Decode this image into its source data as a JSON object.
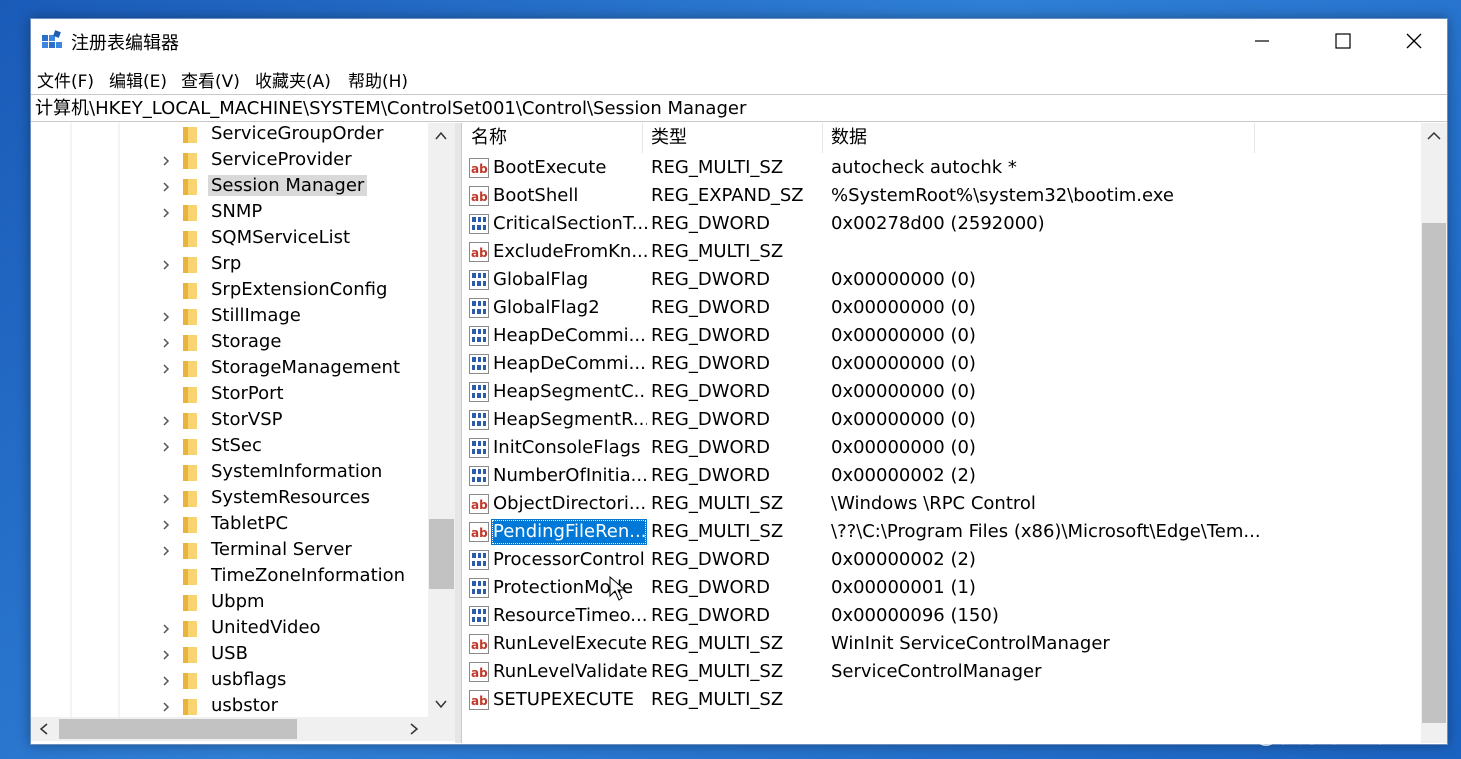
{
  "window": {
    "title": "注册表编辑器"
  },
  "menu": [
    "文件(F)",
    "编辑(E)",
    "查看(V)",
    "收藏夹(A)",
    "帮助(H)"
  ],
  "address": "计算机\\HKEY_LOCAL_MACHINE\\SYSTEM\\ControlSet001\\Control\\Session Manager",
  "tree": [
    {
      "label": "ServiceGroupOrder",
      "expandable": false
    },
    {
      "label": "ServiceProvider",
      "expandable": true
    },
    {
      "label": "Session Manager",
      "expandable": true,
      "selected": true
    },
    {
      "label": "SNMP",
      "expandable": true
    },
    {
      "label": "SQMServiceList",
      "expandable": false
    },
    {
      "label": "Srp",
      "expandable": true
    },
    {
      "label": "SrpExtensionConfig",
      "expandable": false
    },
    {
      "label": "StillImage",
      "expandable": true
    },
    {
      "label": "Storage",
      "expandable": true
    },
    {
      "label": "StorageManagement",
      "expandable": true
    },
    {
      "label": "StorPort",
      "expandable": false
    },
    {
      "label": "StorVSP",
      "expandable": true
    },
    {
      "label": "StSec",
      "expandable": true
    },
    {
      "label": "SystemInformation",
      "expandable": false
    },
    {
      "label": "SystemResources",
      "expandable": true
    },
    {
      "label": "TabletPC",
      "expandable": true
    },
    {
      "label": "Terminal Server",
      "expandable": true
    },
    {
      "label": "TimeZoneInformation",
      "expandable": false
    },
    {
      "label": "Ubpm",
      "expandable": false
    },
    {
      "label": "UnitedVideo",
      "expandable": true
    },
    {
      "label": "USB",
      "expandable": true
    },
    {
      "label": "usbflags",
      "expandable": true
    },
    {
      "label": "usbstor",
      "expandable": true
    }
  ],
  "columns": [
    "名称",
    "类型",
    "数据"
  ],
  "values": [
    {
      "name": "BootExecute",
      "type": "REG_MULTI_SZ",
      "data": "autocheck autochk *",
      "icon": "string-value-icon"
    },
    {
      "name": "BootShell",
      "type": "REG_EXPAND_SZ",
      "data": "%SystemRoot%\\system32\\bootim.exe",
      "icon": "string-value-icon"
    },
    {
      "name": "CriticalSectionT...",
      "type": "REG_DWORD",
      "data": "0x00278d00 (2592000)",
      "icon": "binary-value-icon"
    },
    {
      "name": "ExcludeFromKn...",
      "type": "REG_MULTI_SZ",
      "data": "",
      "icon": "string-value-icon"
    },
    {
      "name": "GlobalFlag",
      "type": "REG_DWORD",
      "data": "0x00000000 (0)",
      "icon": "binary-value-icon"
    },
    {
      "name": "GlobalFlag2",
      "type": "REG_DWORD",
      "data": "0x00000000 (0)",
      "icon": "binary-value-icon"
    },
    {
      "name": "HeapDeCommi...",
      "type": "REG_DWORD",
      "data": "0x00000000 (0)",
      "icon": "binary-value-icon"
    },
    {
      "name": "HeapDeCommi...",
      "type": "REG_DWORD",
      "data": "0x00000000 (0)",
      "icon": "binary-value-icon"
    },
    {
      "name": "HeapSegmentC...",
      "type": "REG_DWORD",
      "data": "0x00000000 (0)",
      "icon": "binary-value-icon"
    },
    {
      "name": "HeapSegmentR...",
      "type": "REG_DWORD",
      "data": "0x00000000 (0)",
      "icon": "binary-value-icon"
    },
    {
      "name": "InitConsoleFlags",
      "type": "REG_DWORD",
      "data": "0x00000000 (0)",
      "icon": "binary-value-icon"
    },
    {
      "name": "NumberOfInitia...",
      "type": "REG_DWORD",
      "data": "0x00000002 (2)",
      "icon": "binary-value-icon"
    },
    {
      "name": "ObjectDirectori...",
      "type": "REG_MULTI_SZ",
      "data": "\\Windows \\RPC Control",
      "icon": "string-value-icon"
    },
    {
      "name": "PendingFileRen...",
      "type": "REG_MULTI_SZ",
      "data": "\\??\\C:\\Program Files (x86)\\Microsoft\\Edge\\Tem...",
      "icon": "string-value-icon",
      "selected": true
    },
    {
      "name": "ProcessorControl",
      "type": "REG_DWORD",
      "data": "0x00000002 (2)",
      "icon": "binary-value-icon"
    },
    {
      "name": "ProtectionMode",
      "type": "REG_DWORD",
      "data": "0x00000001 (1)",
      "icon": "binary-value-icon"
    },
    {
      "name": "ResourceTimeo...",
      "type": "REG_DWORD",
      "data": "0x00000096 (150)",
      "icon": "binary-value-icon"
    },
    {
      "name": "RunLevelExecute",
      "type": "REG_MULTI_SZ",
      "data": "WinInit ServiceControlManager",
      "icon": "string-value-icon"
    },
    {
      "name": "RunLevelValidate",
      "type": "REG_MULTI_SZ",
      "data": "ServiceControlManager",
      "icon": "string-value-icon"
    },
    {
      "name": "SETUPEXECUTE",
      "type": "REG_MULTI_SZ",
      "data": "",
      "icon": "string-value-icon"
    }
  ],
  "watermark": "CSDN @快乐学编程吧"
}
